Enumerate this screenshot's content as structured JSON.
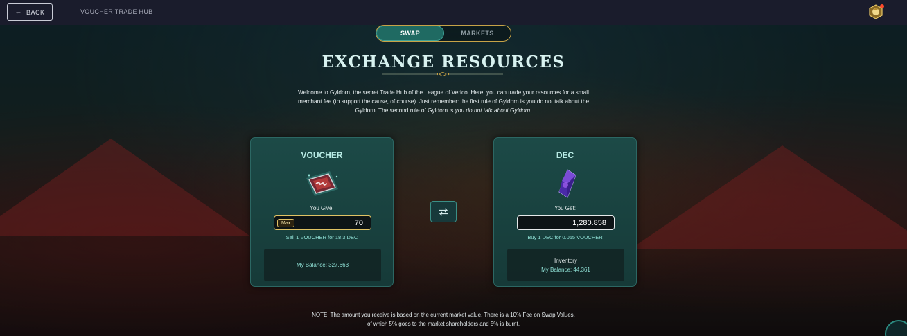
{
  "topbar": {
    "back_label": "BACK",
    "title": "VOUCHER TRADE HUB"
  },
  "tabs": [
    {
      "label": "SWAP",
      "active": true
    },
    {
      "label": "MARKETS",
      "active": false
    }
  ],
  "heading": "EXCHANGE RESOURCES",
  "intro": {
    "text": "Welcome to Gyldorn, the secret Trade Hub of the League of Verico. Here, you can trade your resources for a small merchant fee (to support the cause, of course). Just remember: the first rule of Gyldorn is you do not talk about the Gyldorn. The second rule of Gyldorn is ",
    "emphasis": "you do not talk about Gyldorn."
  },
  "give_panel": {
    "title": "VOUCHER",
    "field_label": "You Give:",
    "max_label": "Max",
    "amount": "70",
    "rate": "Sell 1 VOUCHER for 18.3 DEC",
    "balance": "My Balance: 327.663"
  },
  "get_panel": {
    "title": "DEC",
    "field_label": "You Get:",
    "amount": "1,280.858",
    "rate": "Buy 1 DEC for 0.055 VOUCHER",
    "inventory_label": "Inventory",
    "balance": "My Balance: 44.361"
  },
  "note": {
    "line1": "NOTE: The amount you receive is based on the current market value. There is a 10% Fee on Swap Values,",
    "line2": "of which 5% goes to the market shareholders and 5% is burnt."
  },
  "colors": {
    "accent_teal": "#1f6a62",
    "gold": "#e0c264",
    "topbar": "#1a1c2c",
    "rate_text": "#8fe0d5"
  },
  "icons": {
    "back": "back-arrow-icon",
    "avatar": "user-avatar-icon",
    "swap": "swap-arrows-icon",
    "voucher": "voucher-token-icon",
    "dec": "dec-crystal-icon"
  }
}
